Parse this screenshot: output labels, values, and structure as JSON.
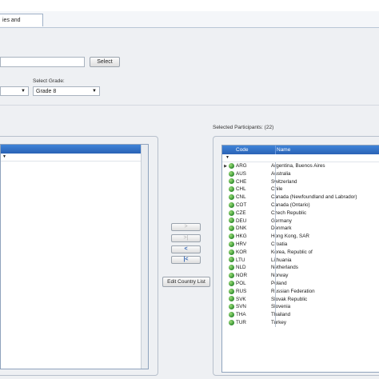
{
  "window": {
    "title_ghost": ""
  },
  "tabs": [
    {
      "label": "ies and Variables"
    }
  ],
  "search": {
    "button": "Select"
  },
  "grade": {
    "label": "Select Grade:",
    "value": "Grade 8"
  },
  "left_select": {
    "value": ""
  },
  "selected_label": "Selected Participants: (22)",
  "move_buttons": [
    {
      "label": ">",
      "enabled": false
    },
    {
      "label": ">|",
      "enabled": false
    },
    {
      "label": "<",
      "enabled": true
    },
    {
      "label": "|<",
      "enabled": true
    }
  ],
  "edit_button": "Edit Country List",
  "right_grid": {
    "columns": [
      "Code",
      "Name"
    ],
    "rows": [
      {
        "code": "ARG",
        "name": "Argentina, Buenos Aires",
        "current": true
      },
      {
        "code": "AUS",
        "name": "Australia"
      },
      {
        "code": "CHE",
        "name": "Switzerland"
      },
      {
        "code": "CHL",
        "name": "Chile"
      },
      {
        "code": "CNL",
        "name": "Canada (Newfoundland and Labrador)"
      },
      {
        "code": "COT",
        "name": "Canada (Ontario)"
      },
      {
        "code": "CZE",
        "name": "Czech Republic"
      },
      {
        "code": "DEU",
        "name": "Germany"
      },
      {
        "code": "DNK",
        "name": "Denmark"
      },
      {
        "code": "HKG",
        "name": "Hong Kong, SAR"
      },
      {
        "code": "HRV",
        "name": "Croatia"
      },
      {
        "code": "KOR",
        "name": "Korea, Republic of"
      },
      {
        "code": "LTU",
        "name": "Lithuania"
      },
      {
        "code": "NLD",
        "name": "Netherlands"
      },
      {
        "code": "NOR",
        "name": "Norway"
      },
      {
        "code": "POL",
        "name": "Poland"
      },
      {
        "code": "RUS",
        "name": "Russian Federation"
      },
      {
        "code": "SVK",
        "name": "Slovak Republic"
      },
      {
        "code": "SVN",
        "name": "Slovenia"
      },
      {
        "code": "THA",
        "name": "Thailand"
      },
      {
        "code": "TUR",
        "name": "Turkey"
      }
    ]
  },
  "left_grid": {
    "filter_glyph": "▼"
  },
  "colors": {
    "header_blue": "#2f6fc6",
    "row_icon_green": "#2e8b2e"
  }
}
